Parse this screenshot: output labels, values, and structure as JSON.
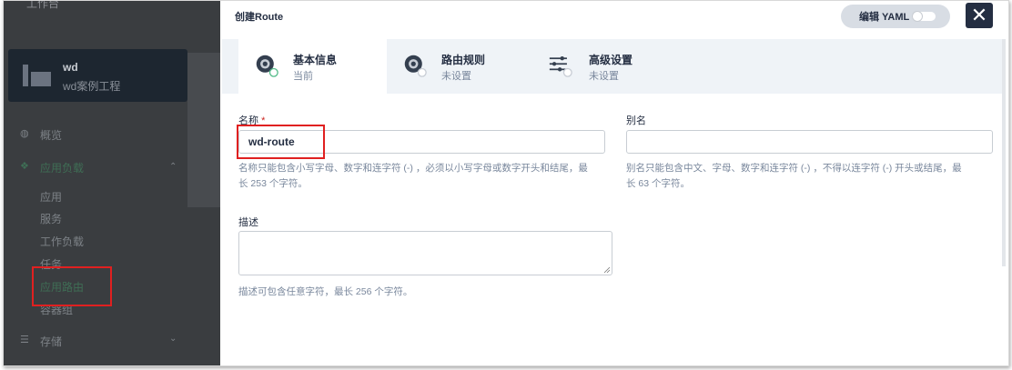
{
  "background": {
    "top_item": "工作台",
    "project": {
      "name": "wd",
      "desc": "wd案例工程"
    },
    "nav": [
      {
        "icon": "overview-icon",
        "glyph": "◍",
        "label": "概览"
      },
      {
        "icon": "app-workload-icon",
        "glyph": "❖",
        "label": "应用负载",
        "chevron": "⌃"
      },
      {
        "icon": "storage-icon",
        "glyph": "☰",
        "label": "存储",
        "chevron": "⌄"
      }
    ],
    "subitems": [
      "应用",
      "服务",
      "工作负载",
      "任务",
      "应用路由",
      "容器组"
    ]
  },
  "modal": {
    "title": "创建Route",
    "yaml_label": "编辑 YAML",
    "close_glyph": "✕",
    "tabs": [
      {
        "title": "基本信息",
        "status": "当前",
        "icon": "basic-info-icon"
      },
      {
        "title": "路由规则",
        "status": "未设置",
        "icon": "route-rules-icon"
      },
      {
        "title": "高级设置",
        "status": "未设置",
        "icon": "advanced-settings-icon"
      }
    ],
    "name_field": {
      "label": "名称",
      "required_mark": "*",
      "value": "wd-route",
      "hint_line1": "名称只能包含小写字母、数字和连字符 (-) ，必须以小写字母或数字开头和结尾，最",
      "hint_line2": "长 253 个字符。"
    },
    "alias_field": {
      "label": "别名",
      "value": "",
      "hint_line1": "别名只能包含中文、字母、数字和连字符 (-) ，不得以连字符 (-) 开头或结尾，最",
      "hint_line2": "长 63 个字符。"
    },
    "desc_field": {
      "label": "描述",
      "value": "",
      "hint": "描述可包含任意字符，最长 256 个字符。"
    }
  }
}
